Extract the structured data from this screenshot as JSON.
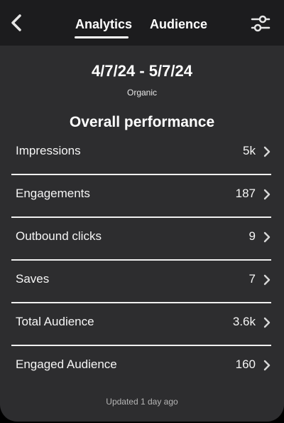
{
  "header": {
    "tabs": [
      {
        "label": "Analytics",
        "active": true
      },
      {
        "label": "Audience",
        "active": false
      }
    ],
    "back_icon": "chevron-left-icon",
    "filter_icon": "sliders-icon"
  },
  "summary": {
    "date_range": "4/7/24 - 5/7/24",
    "content_type": "Organic",
    "section_title": "Overall performance"
  },
  "metrics": [
    {
      "label": "Impressions",
      "value": "5k"
    },
    {
      "label": "Engagements",
      "value": "187"
    },
    {
      "label": "Outbound clicks",
      "value": "9"
    },
    {
      "label": "Saves",
      "value": "7"
    },
    {
      "label": "Total Audience",
      "value": "3.6k"
    },
    {
      "label": "Engaged Audience",
      "value": "160"
    }
  ],
  "footer": {
    "updated": "Updated 1 day ago"
  },
  "colors": {
    "topbar": "#1c1c1e",
    "panel": "#2d2d2f",
    "background": "#000000",
    "text": "#ffffff"
  }
}
